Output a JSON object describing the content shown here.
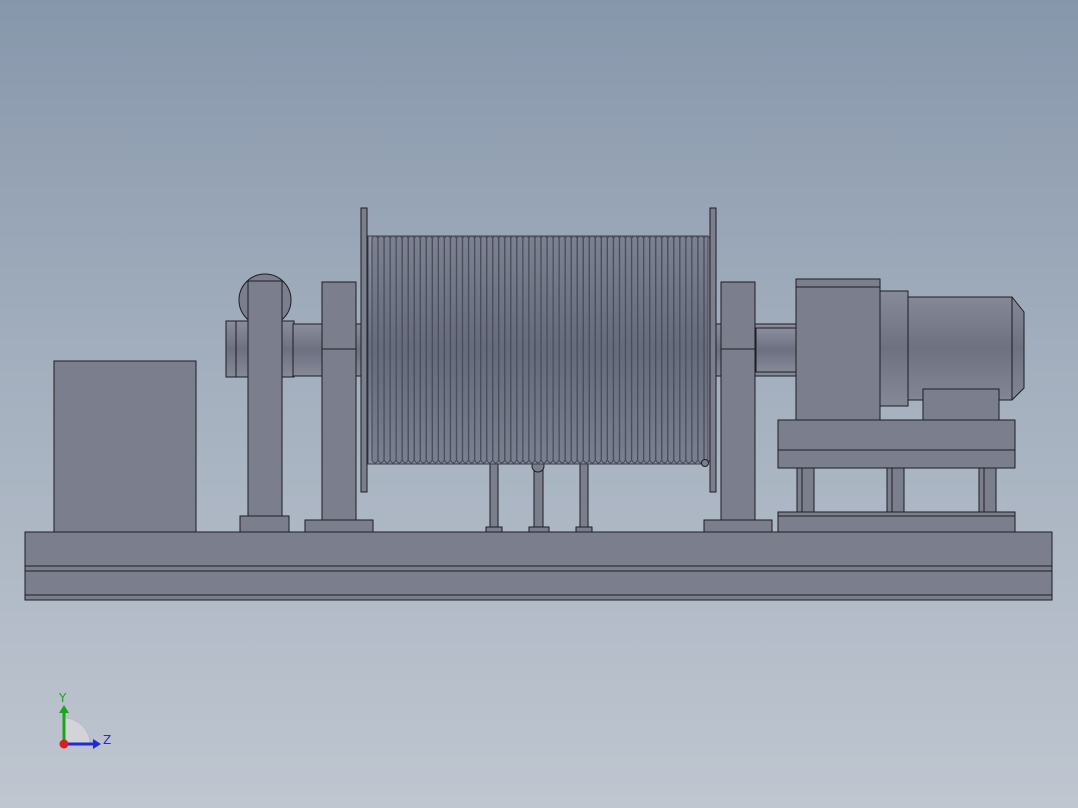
{
  "viewport": {
    "background_top": "#8797ab",
    "background_bottom": "#bfc6d0",
    "model_fill": "#7b7f8d",
    "model_edge": "#1c1d24"
  },
  "triad": {
    "y_label": "Y",
    "z_label": "Z",
    "y_color": "#1aa61a",
    "z_color": "#1f2bd6",
    "x_color": "#d42020"
  },
  "model": {
    "rope_turns": 56
  }
}
